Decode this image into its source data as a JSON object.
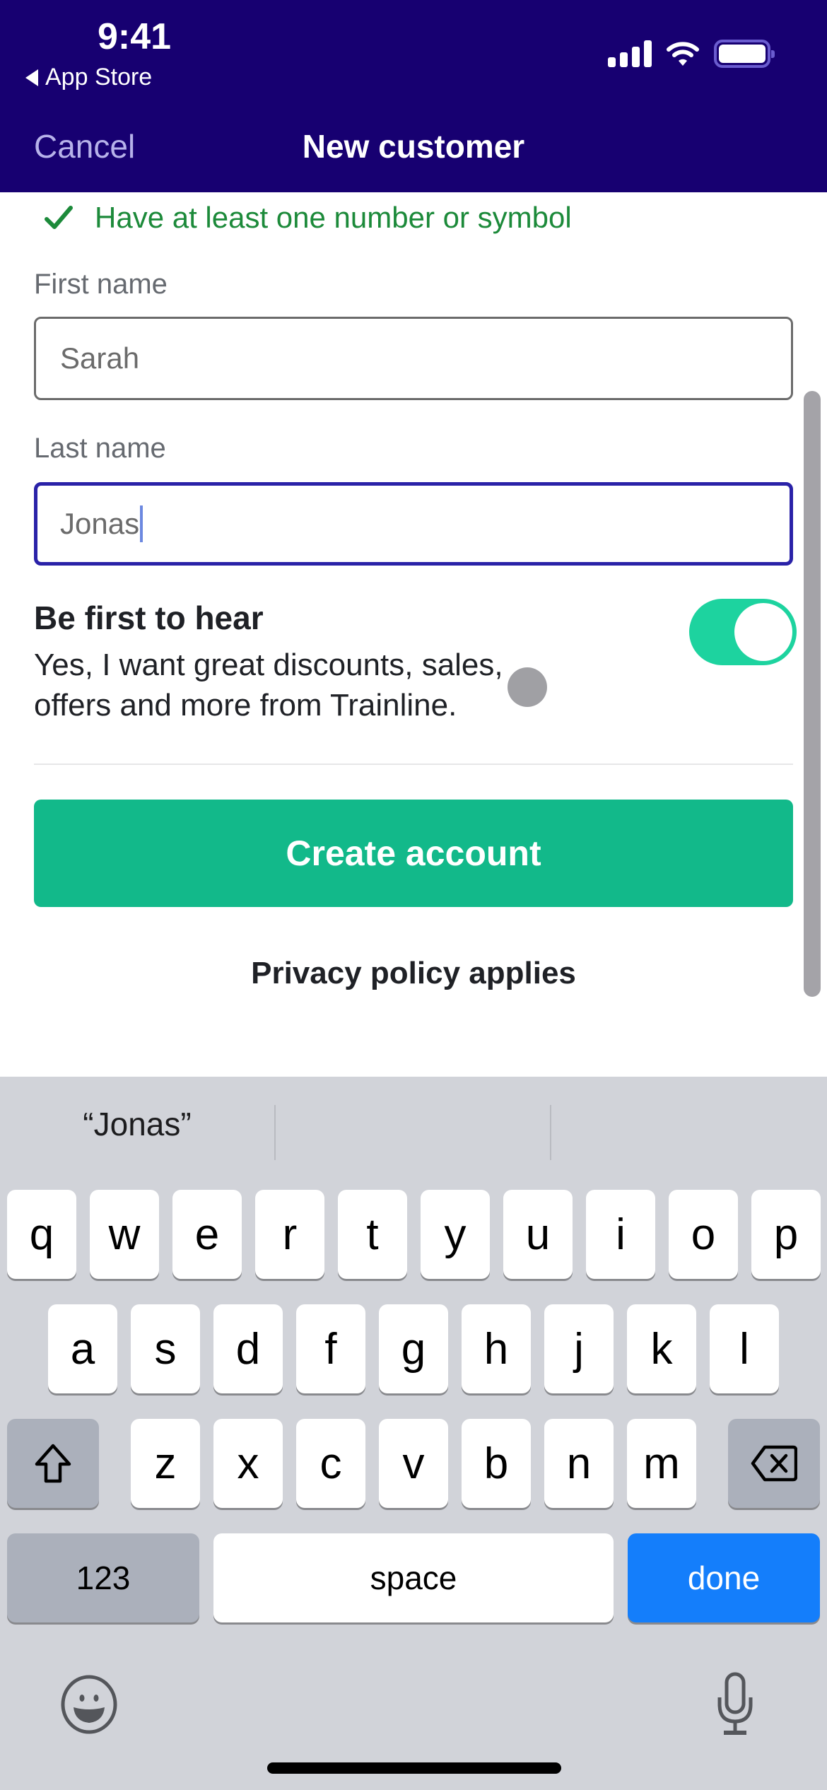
{
  "status_bar": {
    "time": "9:41",
    "back_app": "App Store",
    "icons": [
      "signal-icon",
      "wifi-icon",
      "battery-icon"
    ]
  },
  "nav": {
    "cancel_label": "Cancel",
    "title": "New customer"
  },
  "form": {
    "password_rule": {
      "icon": "checkmark-icon",
      "text": "Have at least one number or symbol",
      "status": "satisfied",
      "color": "#1c8a3a"
    },
    "first_name": {
      "label": "First name",
      "value": "Sarah"
    },
    "last_name": {
      "label": "Last name",
      "value": "Jonas",
      "focused": true
    },
    "marketing": {
      "title": "Be first to hear",
      "body": "Yes, I want great discounts, sales, offers and more from Trainline.",
      "toggle_on": true
    },
    "submit_label": "Create account",
    "privacy_label": "Privacy policy applies"
  },
  "colors": {
    "header_bg": "#170071",
    "primary_button": "#12b98a",
    "toggle_on": "#1dd39f",
    "focus_border": "#2a22a8",
    "keyboard_done": "#147efb"
  },
  "keyboard": {
    "suggestions": [
      "“Jonas”",
      "",
      ""
    ],
    "row1": [
      "q",
      "w",
      "e",
      "r",
      "t",
      "y",
      "u",
      "i",
      "o",
      "p"
    ],
    "row2": [
      "a",
      "s",
      "d",
      "f",
      "g",
      "h",
      "j",
      "k",
      "l"
    ],
    "row3": [
      "z",
      "x",
      "c",
      "v",
      "b",
      "n",
      "m"
    ],
    "numbers_label": "123",
    "space_label": "space",
    "done_label": "done"
  }
}
